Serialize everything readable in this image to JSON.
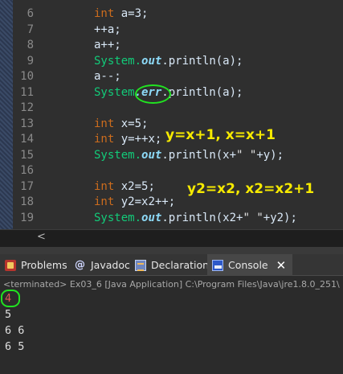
{
  "editor": {
    "line_numbers": [
      "6",
      "7",
      "8",
      "9",
      "10",
      "11",
      "12",
      "13",
      "14",
      "15",
      "16",
      "17",
      "18",
      "19"
    ],
    "line6": {
      "kw": "int",
      "rest": " a=3;"
    },
    "line7": {
      "text": "++a;"
    },
    "line8": {
      "text": "a++;"
    },
    "line9": {
      "cls": "System.",
      "fld": "out",
      "rest": ".println(a);"
    },
    "line10": {
      "text": "a--;"
    },
    "line11": {
      "cls": "System",
      "fld": ".err",
      "rest": ".println(a);"
    },
    "line13": {
      "kw": "int",
      "rest": " x=5;"
    },
    "line14": {
      "kw": "int",
      "rest": " y=++x;"
    },
    "line15": {
      "cls": "System.",
      "fld": "out",
      "rest1": ".println(x+",
      "str": "\" \"",
      "rest2": "+y);"
    },
    "line17": {
      "kw": "int",
      "rest": " x2=5;"
    },
    "line18": {
      "kw": "int",
      "rest": " y2=x2++;"
    },
    "line19": {
      "cls": "System.",
      "fld": "out",
      "rest1": ".println(x2+",
      "str": "\" \"",
      "rest2": "+y2);"
    },
    "annotation1": "y=x+1, x=x+1",
    "annotation2": "y2=x2, x2=x2+1",
    "scroll_left_arrow": "<"
  },
  "tabs": [
    {
      "label": "Problems",
      "icon": "problems-icon"
    },
    {
      "label": "Javadoc",
      "icon": "javadoc-icon"
    },
    {
      "label": "Declaration",
      "icon": "declaration-icon"
    },
    {
      "label": "Console",
      "icon": "console-icon",
      "active": true
    }
  ],
  "console": {
    "terminated": "<terminated> Ex03_6 [Java Application] C:\\Program Files\\Java\\jre1.8.0_251\\",
    "output": [
      "4",
      "5",
      "6 6",
      "6 5"
    ]
  },
  "colors": {
    "annotation": "#f6ea00",
    "circle": "#21e321",
    "keyword": "#cc6c1d",
    "static_field": "#8ddaf8",
    "class_name": "#12cb79",
    "error_output": "#e05555"
  }
}
